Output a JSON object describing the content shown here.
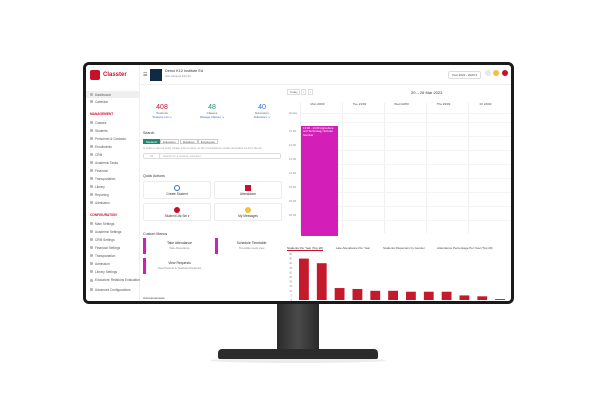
{
  "brand": {
    "name": "Classter",
    "accent": "#c8102e",
    "school_color": "#0e2a47"
  },
  "header": {
    "menu_icon": "hamburger-icon",
    "school_name": "Demo K12 Institute Ed",
    "school_sub": "Aux Campus K12 (F)",
    "year": "Year 2022 - 2023 ▾",
    "icons": [
      "chat-icon",
      "bell-icon",
      "user-avatar-icon"
    ]
  },
  "sidebar": {
    "main": [
      "Dashboard",
      "Calendar"
    ],
    "management_label": "MANAGEMENT",
    "management": [
      "Classes",
      "Students",
      "Personnel & Contacts",
      "Enrollments",
      "CRM",
      "Academic Tasks",
      "Financial",
      "Transportation",
      "Library",
      "Reporting",
      "Admission"
    ],
    "configuration_label": "CONFIGURATION",
    "configuration": [
      "Main Settings",
      "Academic Settings",
      "CRM Settings",
      "Financial Settings",
      "Transportation",
      "Admission",
      "Library Settings",
      "Educators' Relations Evaluation",
      "Advanced Configurations"
    ]
  },
  "stats": [
    {
      "num": "408",
      "label": "Students",
      "link": "Students List ↘",
      "color": "#c8102e"
    },
    {
      "num": "48",
      "label": "Classes",
      "link": "Manage Classes ↘",
      "color": "#1f8a74"
    },
    {
      "num": "40",
      "label": "Educators",
      "link": "Educators ↘",
      "color": "#2a6dd6"
    }
  ],
  "search": {
    "title": "Search",
    "tabs": [
      "Students",
      "Educators",
      "Relatives",
      "Employees"
    ],
    "hint": "In order to start an entity, please enter a name, an ID or a telephone number and select out from the list",
    "select": "All",
    "placeholder": "Search for a student, educator..."
  },
  "quick_actions": {
    "title": "Quick Actions",
    "items": [
      "Create Student",
      "Attendance",
      "Student List Sel ▾",
      "My Messages"
    ]
  },
  "custom_menus": {
    "title": "Custom Menus",
    "items": [
      {
        "title": "Take Attendance",
        "sub": "Take Attendance"
      },
      {
        "title": "Schedule Timetable",
        "sub": "Timetable week view"
      },
      {
        "title": "View Requests",
        "sub": "View Parents & Teachers Requests"
      }
    ]
  },
  "announcements": "Announcements",
  "calendar": {
    "today": "Today",
    "range": "20 – 26 Mar 2023",
    "days": [
      "Mon 20/03",
      "Tue 21/03",
      "Wed 22/03",
      "Thu 23/03",
      "Fri 24/03"
    ],
    "allday": "all-day",
    "times": [
      "13:00",
      "13:30",
      "14:00",
      "14:30",
      "15:00",
      "15:30",
      "16:00"
    ],
    "event": "13:00 - 14:00 Agriculture and Technology Scholar Seminar"
  },
  "chart_tabs": [
    "Students Per Year (Top 20)",
    "Late Attendance Per Year",
    "Students Dispersion by Gender",
    "Attendance Percentage Per Year (Top 20)"
  ],
  "chart_data": {
    "type": "bar",
    "title": "Students Per Year (Top 20)",
    "yticks": [
      "50",
      "45",
      "40",
      "35",
      "30",
      "25",
      "20",
      "15",
      "10",
      "5",
      "0"
    ],
    "ylim": [
      0,
      50
    ],
    "values": [
      45,
      40,
      13,
      12,
      10,
      10,
      9,
      9,
      9,
      5,
      4,
      1
    ],
    "color": "#c41a2b"
  }
}
